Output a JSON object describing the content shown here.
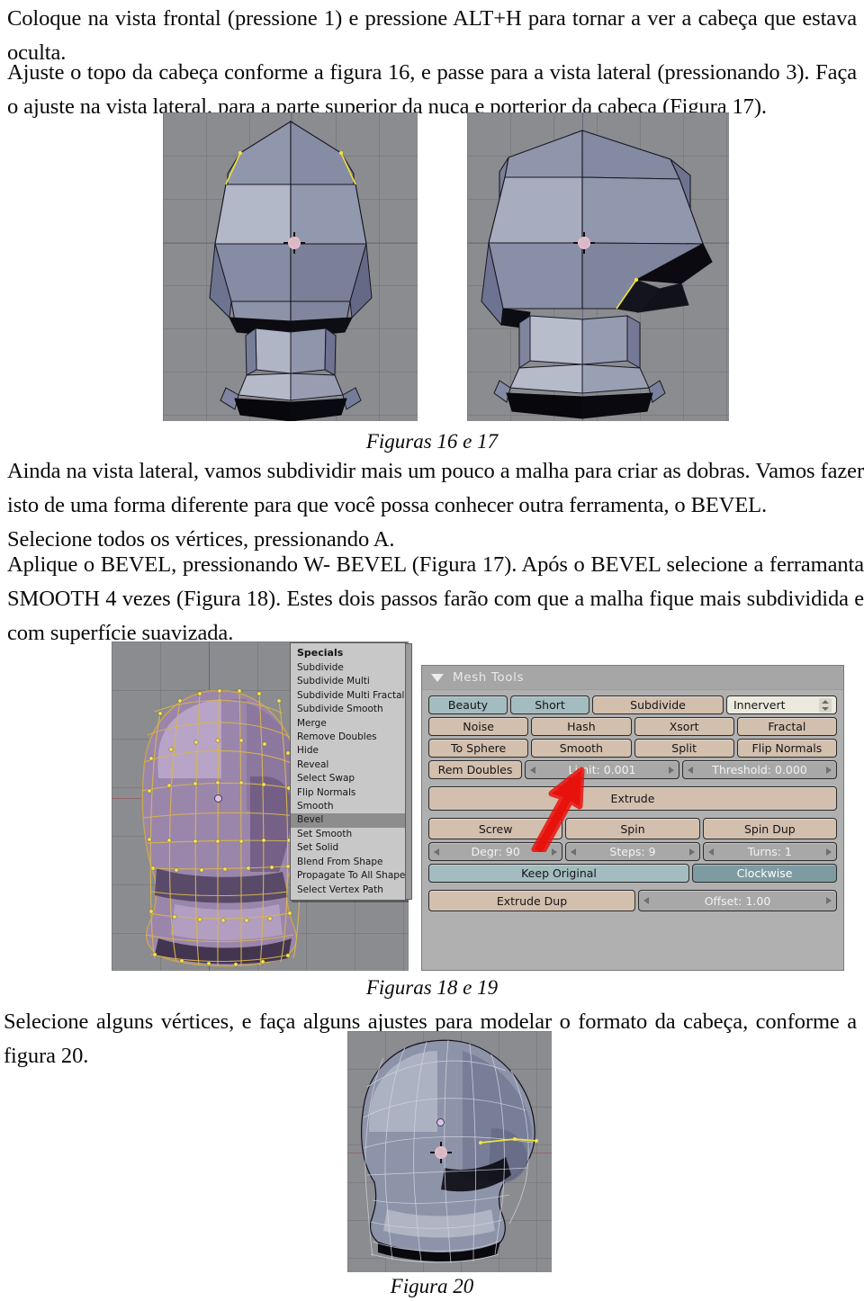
{
  "document": {
    "paragraphs": [
      {
        "id": "p1",
        "text": "Coloque na vista frontal (pressione 1) e pressione ALT+H para tornar a ver a cabeça que estava oculta."
      },
      {
        "id": "p2",
        "text": "Ajuste o topo da cabeça conforme a figura 16, e passe para a vista lateral (pressionando 3). Faça o ajuste na vista lateral, para a parte superior da nuca e porterior da cabeça (Figura 17)."
      },
      {
        "id": "p3",
        "text": "Ainda na vista lateral, vamos subdividir mais um pouco a malha para criar as dobras. Vamos fazer isto de uma forma diferente para que você possa conhecer outra ferramenta, o BEVEL."
      },
      {
        "id": "p4",
        "text": "Selecione todos os vértices, pressionando A."
      },
      {
        "id": "p5",
        "text": "Aplique o BEVEL, pressionando W- BEVEL (Figura 17).  Após o BEVEL selecione a ferramanta SMOOTH 4 vezes (Figura 18). Estes dois passos farão com que a malha fique mais subdividida e com superfície suavizada."
      },
      {
        "id": "p6",
        "text": "Selecione alguns vértices, e faça alguns ajustes para modelar o formato da cabeça, conforme a figura 20."
      }
    ],
    "captions": [
      {
        "id": "c1",
        "text": "Figuras 16 e 17"
      },
      {
        "id": "c2",
        "text": "Figuras 18  e 19"
      },
      {
        "id": "c3",
        "text": "Figura 20"
      }
    ]
  },
  "figures": {
    "fig16": {
      "alt": "Vista frontal da cabeça poligonal em sombreamento sólido"
    },
    "fig17": {
      "alt": "Vista lateral da cabeça poligonal em sombreamento sólido"
    },
    "fig18": {
      "alt": "Malha da cabeça subdividida com todos os vértices selecionados"
    },
    "fig20": {
      "alt": "Cabeça modelada em vista lateral após ajustes de vértices"
    }
  },
  "specials_menu": {
    "title": "Specials",
    "selected": "Bevel",
    "items": [
      "Subdivide",
      "Subdivide Multi",
      "Subdivide Multi Fractal",
      "Subdivide Smooth",
      "Merge",
      "Remove Doubles",
      "Hide",
      "Reveal",
      "Select Swap",
      "Flip Normals",
      "Smooth",
      "Bevel",
      "Set Smooth",
      "Set Solid",
      "Blend From Shape",
      "Propagate To All Shapes",
      "Select Vertex Path"
    ]
  },
  "mesh_tools": {
    "title": "Mesh Tools",
    "row1": [
      {
        "label": "Beauty",
        "style": "teal"
      },
      {
        "label": "Short",
        "style": "teal"
      },
      {
        "label": "Subdivide",
        "style": "tan"
      },
      {
        "label": "Innervert",
        "style": "field"
      }
    ],
    "row2": [
      {
        "label": "Noise",
        "style": "tan"
      },
      {
        "label": "Hash",
        "style": "tan"
      },
      {
        "label": "Xsort",
        "style": "tan"
      },
      {
        "label": "Fractal",
        "style": "tan"
      }
    ],
    "row3": [
      {
        "label": "To Sphere",
        "style": "tan"
      },
      {
        "label": "Smooth",
        "style": "tan"
      },
      {
        "label": "Split",
        "style": "tan"
      },
      {
        "label": "Flip Normals",
        "style": "tan"
      }
    ],
    "row4": [
      {
        "label": "Rem Doubles",
        "style": "tan"
      },
      {
        "label": "Limit: 0.001",
        "style": "num"
      },
      {
        "label": "Threshold: 0.000",
        "style": "num"
      }
    ],
    "extrude": {
      "label": "Extrude",
      "style": "tan"
    },
    "row6": [
      {
        "label": "Screw",
        "style": "tan"
      },
      {
        "label": "Spin",
        "style": "tan"
      },
      {
        "label": "Spin Dup",
        "style": "tan"
      }
    ],
    "row7": [
      {
        "label": "Degr: 90",
        "style": "num"
      },
      {
        "label": "Steps: 9",
        "style": "num"
      },
      {
        "label": "Turns: 1",
        "style": "num"
      }
    ],
    "row8": [
      {
        "label": "Keep Original",
        "style": "teal"
      },
      {
        "label": "Clockwise",
        "style": "teal2"
      }
    ],
    "row9": [
      {
        "label": "Extrude Dup",
        "style": "tan"
      },
      {
        "label": "Offset: 1.00",
        "style": "num"
      }
    ]
  },
  "annotation": {
    "arrow_color": "#e8120c",
    "points_to": "Smooth"
  },
  "colors": {
    "viewport_bg": "#8a8c8f",
    "mesh_light": "#b7bbcc",
    "mesh_mid": "#8a8fa6",
    "mesh_dark": "#5e6277",
    "mesh_shadow": "#0a0a10",
    "selected_vertex": "#f2e23c",
    "panel_bg": "#b0b0b0",
    "button_tan": "#d3bfae"
  }
}
